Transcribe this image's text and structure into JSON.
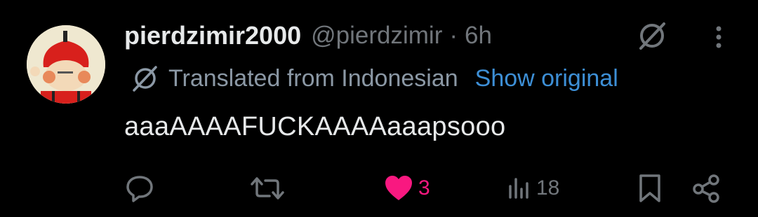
{
  "tweet": {
    "display_name": "pierdzimir2000",
    "handle": "@pierdzimir",
    "separator": "·",
    "time": "6h",
    "translation_label": "Translated from Indonesian",
    "show_original": "Show original",
    "text": "aaaAAAAFUCKAAAAaaapsooo"
  },
  "actions": {
    "likes": "3",
    "views": "18"
  },
  "icons": {
    "reply": "reply-icon",
    "retweet": "retweet-icon",
    "like": "heart-icon",
    "views": "views-icon",
    "bookmark": "bookmark-icon",
    "share": "share-icon",
    "grok": "grok-icon",
    "more": "more-icon",
    "translate": "translate-icon"
  },
  "colors": {
    "background": "#000000",
    "text": "#e7e9ea",
    "muted": "#71767b",
    "link": "#3d8fd6",
    "like": "#f91880"
  }
}
